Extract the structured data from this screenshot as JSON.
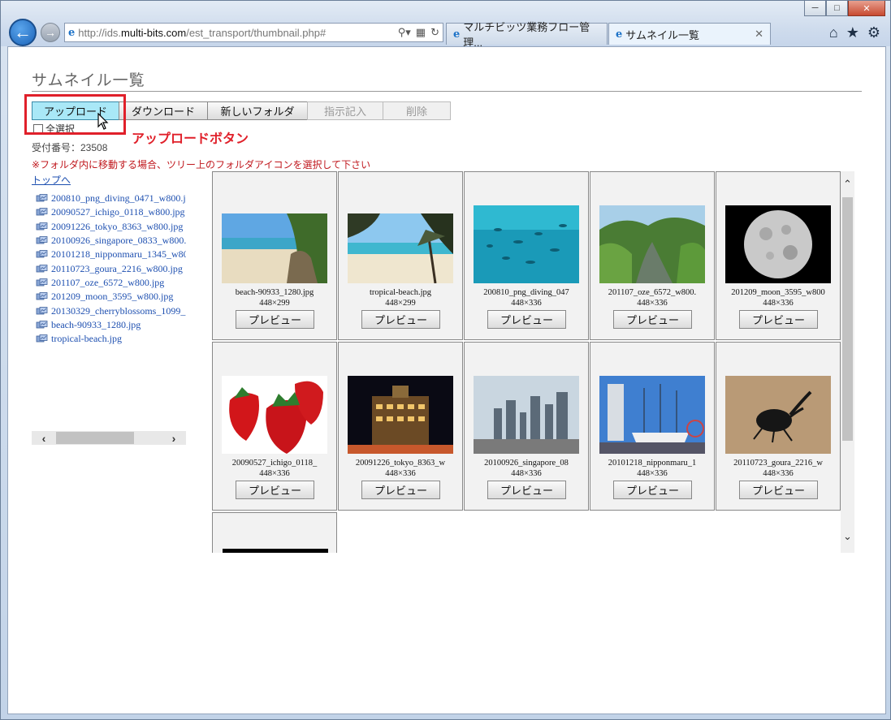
{
  "browser": {
    "address": {
      "prefix": "http://ids.",
      "domain": "multi-bits.com",
      "path": "/est_transport/thumbnail.php#"
    },
    "tabs": [
      {
        "label": "マルチビッツ業務フロー管理..."
      },
      {
        "label": "サムネイル一覧"
      }
    ],
    "accent": "#1b63b8"
  },
  "page": {
    "title": "サムネイル一覧",
    "toolbar": {
      "upload": "アップロード",
      "download": "ダウンロード",
      "new_folder": "新しいフォルダ",
      "instruction": "指示記入",
      "delete": "削除"
    },
    "select_all": "全選択",
    "annotation": "アップロードボタン",
    "receipt": "受付番号：23508",
    "notice": "※フォルダ内に移動する場合、ツリー上のフォルダアイコンを選択して下さい",
    "highlight_color": "#e0202a"
  },
  "tree": {
    "top_link": "トップへ",
    "items": [
      "200810_png_diving_0471_w800.j",
      "20090527_ichigo_0118_w800.jpg",
      "20091226_tokyo_8363_w800.jpg",
      "20100926_singapore_0833_w800.",
      "20101218_nipponmaru_1345_w80",
      "20110723_goura_2216_w800.jpg",
      "201107_oze_6572_w800.jpg",
      "201209_moon_3595_w800.jpg",
      "20130329_cherryblossoms_1099_",
      "beach-90933_1280.jpg",
      "tropical-beach.jpg"
    ]
  },
  "thumbnails": [
    {
      "name": "beach-90933_1280.jpg",
      "dims": "448×299",
      "button": "プレビュー",
      "icon": "beach-image"
    },
    {
      "name": "tropical-beach.jpg",
      "dims": "448×299",
      "button": "プレビュー",
      "icon": "tropical-beach-image"
    },
    {
      "name": "200810_png_diving_047",
      "dims": "448×336",
      "button": "プレビュー",
      "icon": "diving-fish-image"
    },
    {
      "name": "201107_oze_6572_w800.",
      "dims": "448×336",
      "button": "プレビュー",
      "icon": "river-image"
    },
    {
      "name": "201209_moon_3595_w800",
      "dims": "448×336",
      "button": "プレビュー",
      "icon": "moon-image"
    },
    {
      "name": "20090527_ichigo_0118_",
      "dims": "448×336",
      "button": "プレビュー",
      "icon": "strawberry-image"
    },
    {
      "name": "20091226_tokyo_8363_w",
      "dims": "448×336",
      "button": "プレビュー",
      "icon": "tokyo-night-image"
    },
    {
      "name": "20100926_singapore_08",
      "dims": "448×336",
      "button": "プレビュー",
      "icon": "singapore-skyline-image"
    },
    {
      "name": "20101218_nipponmaru_1",
      "dims": "448×336",
      "button": "プレビュー",
      "icon": "ship-image"
    },
    {
      "name": "20110723_goura_2216_w",
      "dims": "448×336",
      "button": "プレビュー",
      "icon": "beetle-image"
    }
  ]
}
